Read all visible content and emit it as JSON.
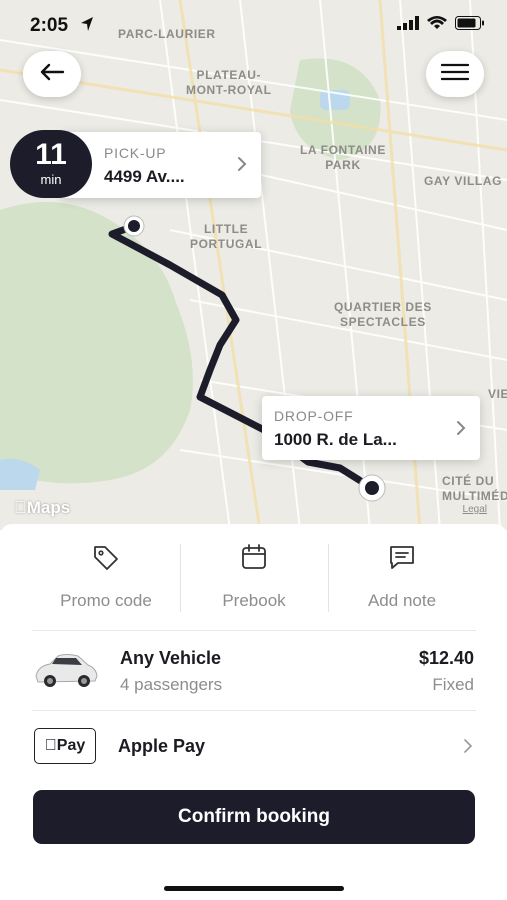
{
  "status_bar": {
    "time": "2:05"
  },
  "map": {
    "labels": [
      {
        "text": "PARC-LAURIER"
      },
      {
        "text": "PLATEAU-\nMONT-ROYAL"
      },
      {
        "text": "LA FONTAINE\nPARK"
      },
      {
        "text": "GAY VILLAG"
      },
      {
        "text": "LITTLE\nPORTUGAL"
      },
      {
        "text": "QUARTIER DES\nSPECTACLES"
      },
      {
        "text": "VIE"
      },
      {
        "text": "CITÉ DU\nMULTIMÉD"
      }
    ],
    "maps_brand": "Maps",
    "legal": "Legal",
    "eta": {
      "number": "11",
      "unit": "min"
    },
    "pickup": {
      "label": "PICK-UP",
      "address": "4499 Av...."
    },
    "dropoff": {
      "label": "DROP-OFF",
      "address": "1000 R. de La..."
    }
  },
  "actions": [
    {
      "label": "Promo code",
      "icon": "tag-icon"
    },
    {
      "label": "Prebook",
      "icon": "calendar-icon"
    },
    {
      "label": "Add note",
      "icon": "message-icon"
    }
  ],
  "vehicle": {
    "name": "Any Vehicle",
    "passengers": "4 passengers",
    "price": "$12.40",
    "pricing_type": "Fixed"
  },
  "payment": {
    "badge": "Pay",
    "method": "Apple Pay"
  },
  "confirm_label": "Confirm booking",
  "colors": {
    "dark": "#1d1c2b",
    "route": "#1d1c2b"
  }
}
